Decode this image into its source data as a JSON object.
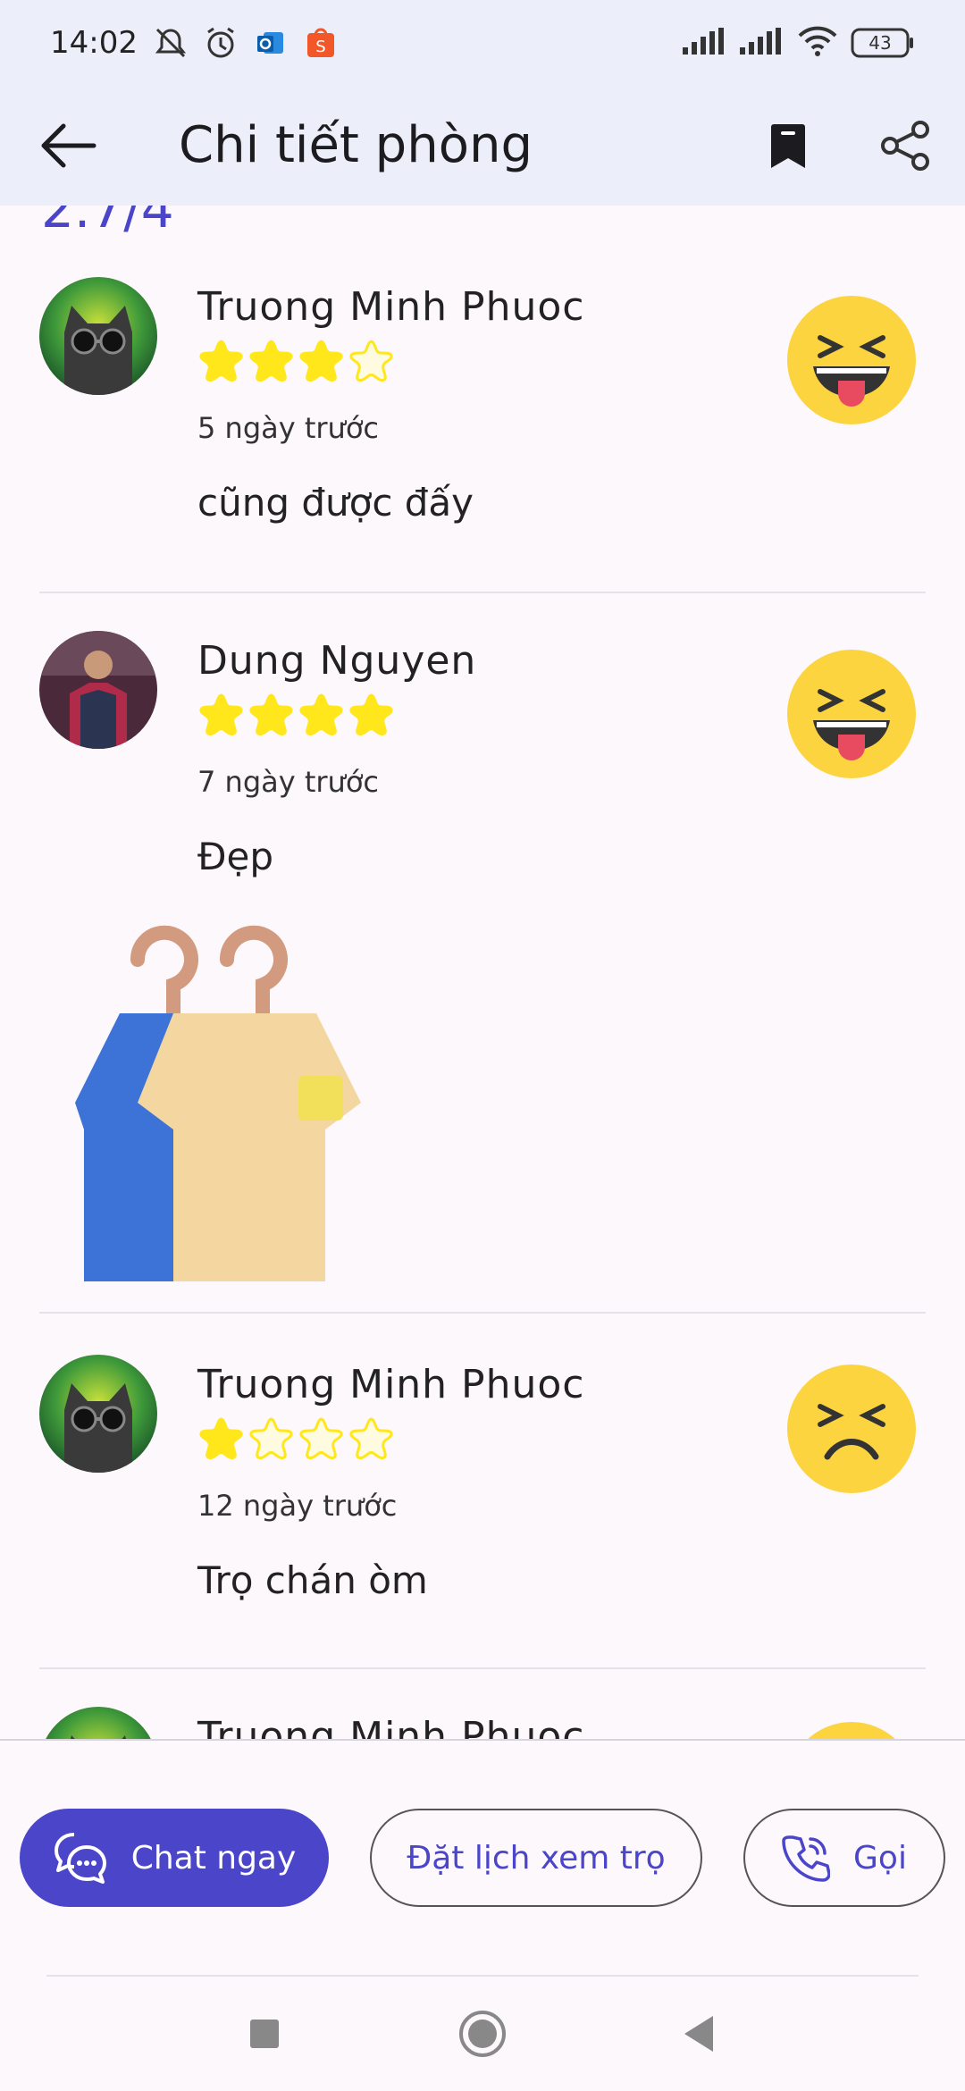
{
  "status_bar": {
    "time": "14:02",
    "battery": "43",
    "icons": [
      "mute-icon",
      "alarm-icon",
      "outlook-icon",
      "shopee-icon",
      "signal-icon",
      "signal-icon",
      "wifi-icon",
      "battery-icon"
    ]
  },
  "app_bar": {
    "title": "Chi tiết phòng",
    "icons": [
      "back-arrow-icon",
      "bookmark-icon",
      "share-icon"
    ]
  },
  "rating_partial": "2.7/4",
  "reviews": [
    {
      "name": "Truong Minh Phuoc",
      "rating": 3,
      "max_rating": 4,
      "time_ago": "5 ngày trước",
      "comment": "cũng được đấy",
      "emoji": "tongue-out-emoji-icon"
    },
    {
      "name": "Dung Nguyen",
      "rating": 4,
      "max_rating": 4,
      "time_ago": "7 ngày trước",
      "comment": "Đẹp",
      "emoji": "tongue-out-emoji-icon",
      "photo": "clothes-hangers-image"
    },
    {
      "name": "Truong Minh Phuoc",
      "rating": 1,
      "max_rating": 4,
      "time_ago": "12 ngày trước",
      "comment": "Trọ chán òm",
      "emoji": "frustrated-emoji-icon"
    },
    {
      "name": "Truong Minh Phuoc",
      "partial": true
    }
  ],
  "actions": {
    "chat_label": "Chat ngay",
    "schedule_label": "Đặt lịch xem trọ",
    "call_label": "Gọi"
  },
  "colors": {
    "primary": "#4a45c9",
    "star": "#ffe71c",
    "header_bg": "#eceff9",
    "page_bg": "#fdf8fc"
  }
}
